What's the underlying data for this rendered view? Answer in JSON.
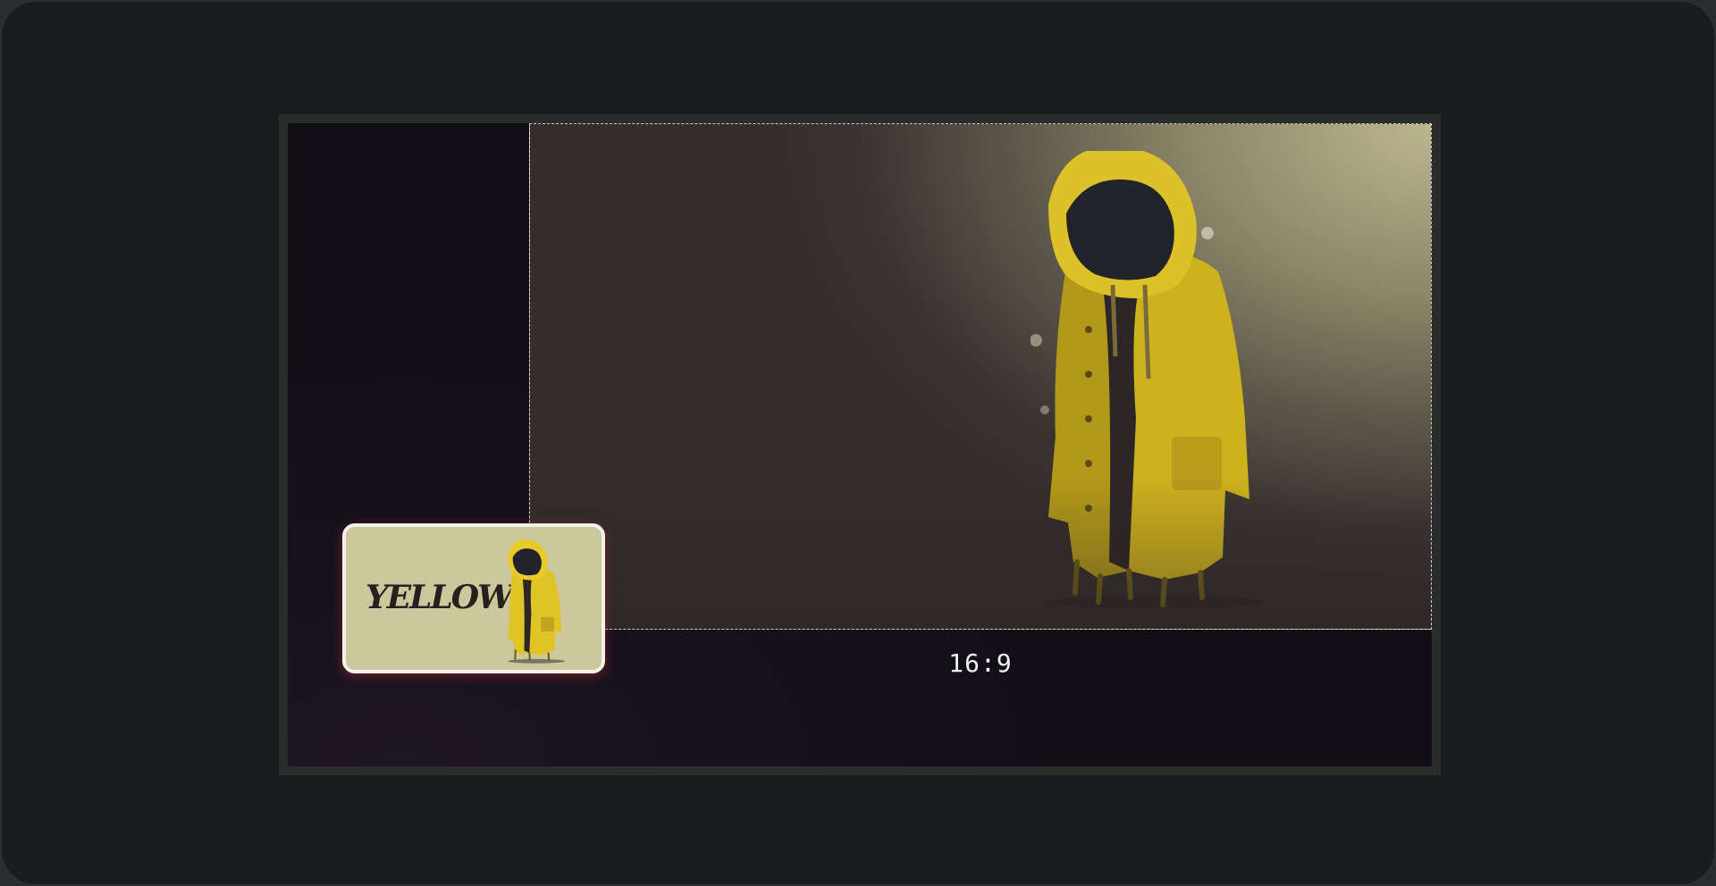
{
  "editor": {
    "aspect_ratio_label": "16:9"
  },
  "thumbnail": {
    "title": "YELLOW"
  },
  "colors": {
    "raincoat": "#d9bd22",
    "raincoat_shadow": "#8a7414",
    "crop_border": "#e8e8e8",
    "stage_bg": "#120e16",
    "thumb_bg": "#ccc79c"
  },
  "icons": {
    "main_image": "raincoat-figure-illustration",
    "thumbnail_image": "raincoat-figure-illustration"
  }
}
